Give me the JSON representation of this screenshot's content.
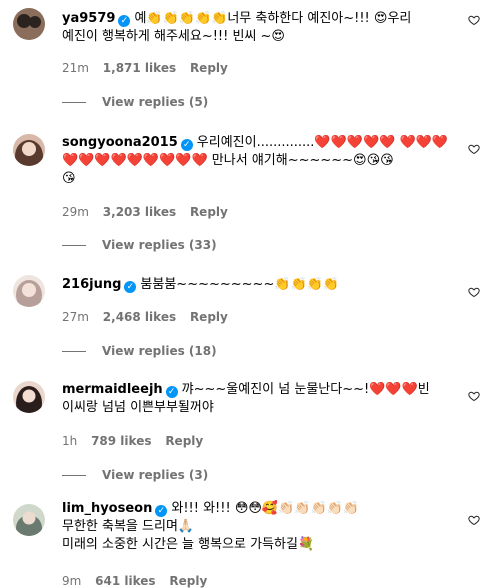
{
  "comments": [
    {
      "username": "ya9579",
      "verified": true,
      "lines": [
        "예👏👏👏👏👏너무 축하한다 예진아~!!! 😍우리",
        "예진이 행복하게 해주세요~!!! 빈씨 ~😍"
      ],
      "time": "21m",
      "likes": "1,871 likes",
      "reply_label": "Reply",
      "view_replies": "View replies (5)",
      "avatar_colors": [
        "#2b2320",
        "#8a6d5a"
      ]
    },
    {
      "username": "songyoona2015",
      "verified": true,
      "lines": [
        "우리예진이..............❤️❤️❤️❤️❤️ ❤️❤️❤️",
        "❤️❤️❤️❤️❤️❤️❤️❤️❤️ 만나서 얘기해~~~~~~😍😘😘",
        "😘"
      ],
      "time": "29m",
      "likes": "3,203 likes",
      "reply_label": "Reply",
      "view_replies": "View replies (33)",
      "avatar_colors": [
        "#5a3a2e",
        "#d8b8a8"
      ]
    },
    {
      "username": "216jung",
      "verified": true,
      "lines": [
        "붐붐붐~~~~~~~~~👏👏👏👏"
      ],
      "time": "27m",
      "likes": "2,468 likes",
      "reply_label": "Reply",
      "view_replies": "View replies (18)",
      "avatar_colors": [
        "#b8a09a",
        "#efe4e0"
      ]
    },
    {
      "username": "mermaidleejh",
      "verified": true,
      "lines": [
        "꺄~~~울예진이 넘 눈물난다~~!❤️❤️❤️빈",
        "이씨랑 넘넘 이쁜부부될꺼야"
      ],
      "time": "1h",
      "likes": "789 likes",
      "reply_label": "Reply",
      "view_replies": "View replies (3)",
      "avatar_colors": [
        "#2a1e1c",
        "#e9d6cc"
      ]
    },
    {
      "username": "lim_hyoseon",
      "verified": true,
      "lines": [
        "와!!! 와!!! 😳😳🥰👏🏻👏🏻👏🏻👏🏻👏🏻",
        "무한한 축복을 드리며🙏🏻",
        "미래의 소중한 시간은 늘 행복으로 가득하길💐"
      ],
      "time": "9m",
      "likes": "641 likes",
      "reply_label": "Reply",
      "view_replies": "",
      "avatar_colors": [
        "#6a7a70",
        "#d0d8cc"
      ]
    }
  ],
  "colors": {
    "verified": "#0095f6",
    "meta": "#737373"
  }
}
